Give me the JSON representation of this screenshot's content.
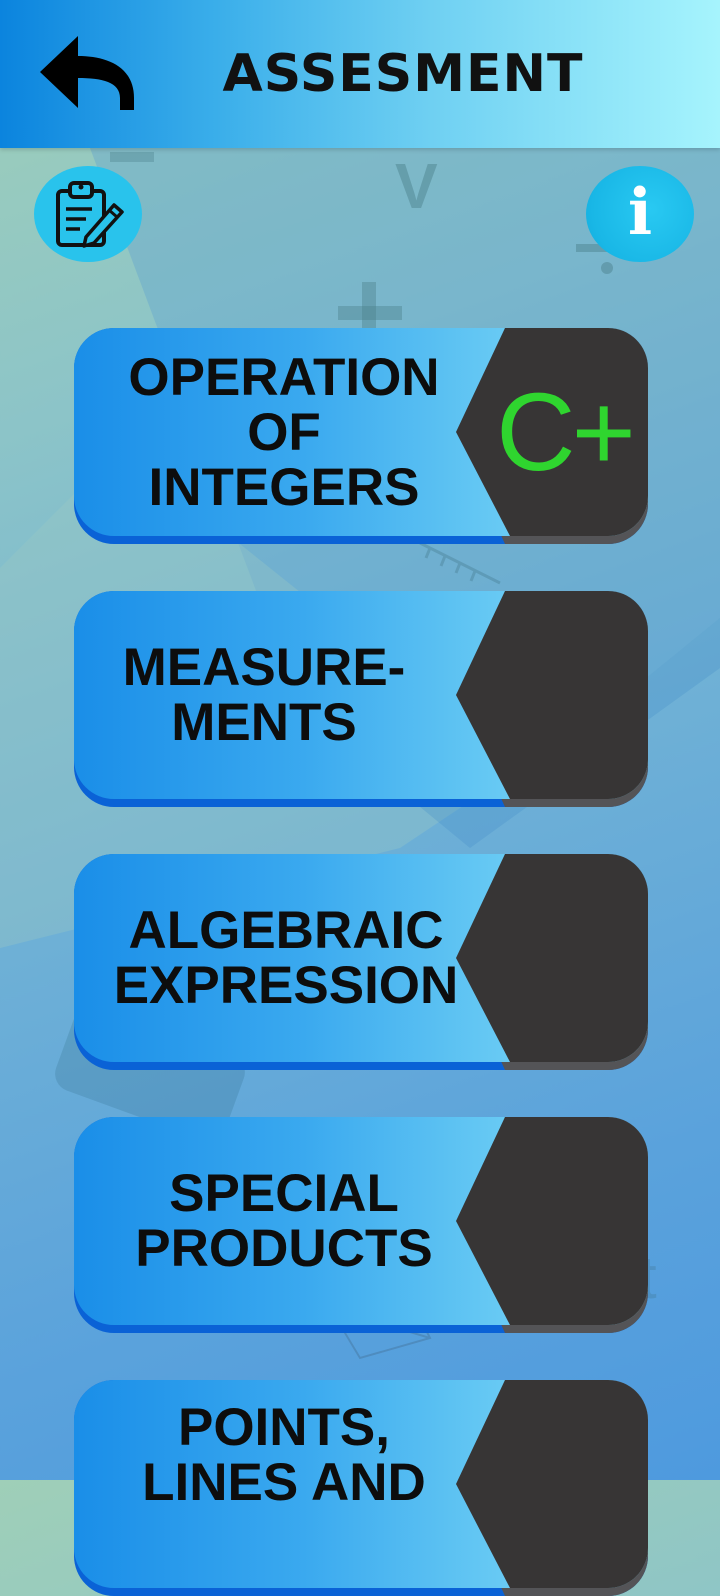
{
  "header": {
    "title": "ASSESMENT",
    "back_icon": "back-arrow-icon"
  },
  "toolbar": {
    "clipboard_icon": "clipboard-edit-icon",
    "info_icon": "info-icon",
    "info_glyph": "i"
  },
  "colors": {
    "header_start": "#0b84de",
    "header_end": "#a6f4fd",
    "circle_button": "#29c3ec",
    "card_blue": "#3aa9ef",
    "card_dark": "#373535",
    "grade_green": "#2fd52f"
  },
  "topics": [
    {
      "label": "OPERATION\nOF\nINTEGERS",
      "grade": "C+"
    },
    {
      "label": "MEASURE-\nMENTS",
      "grade": ""
    },
    {
      "label": "ALGEBRAIC\nEXPRESSION",
      "grade": ""
    },
    {
      "label": "SPECIAL\nPRODUCTS",
      "grade": ""
    },
    {
      "label": "POINTS,\nLINES AND",
      "grade": ""
    }
  ]
}
